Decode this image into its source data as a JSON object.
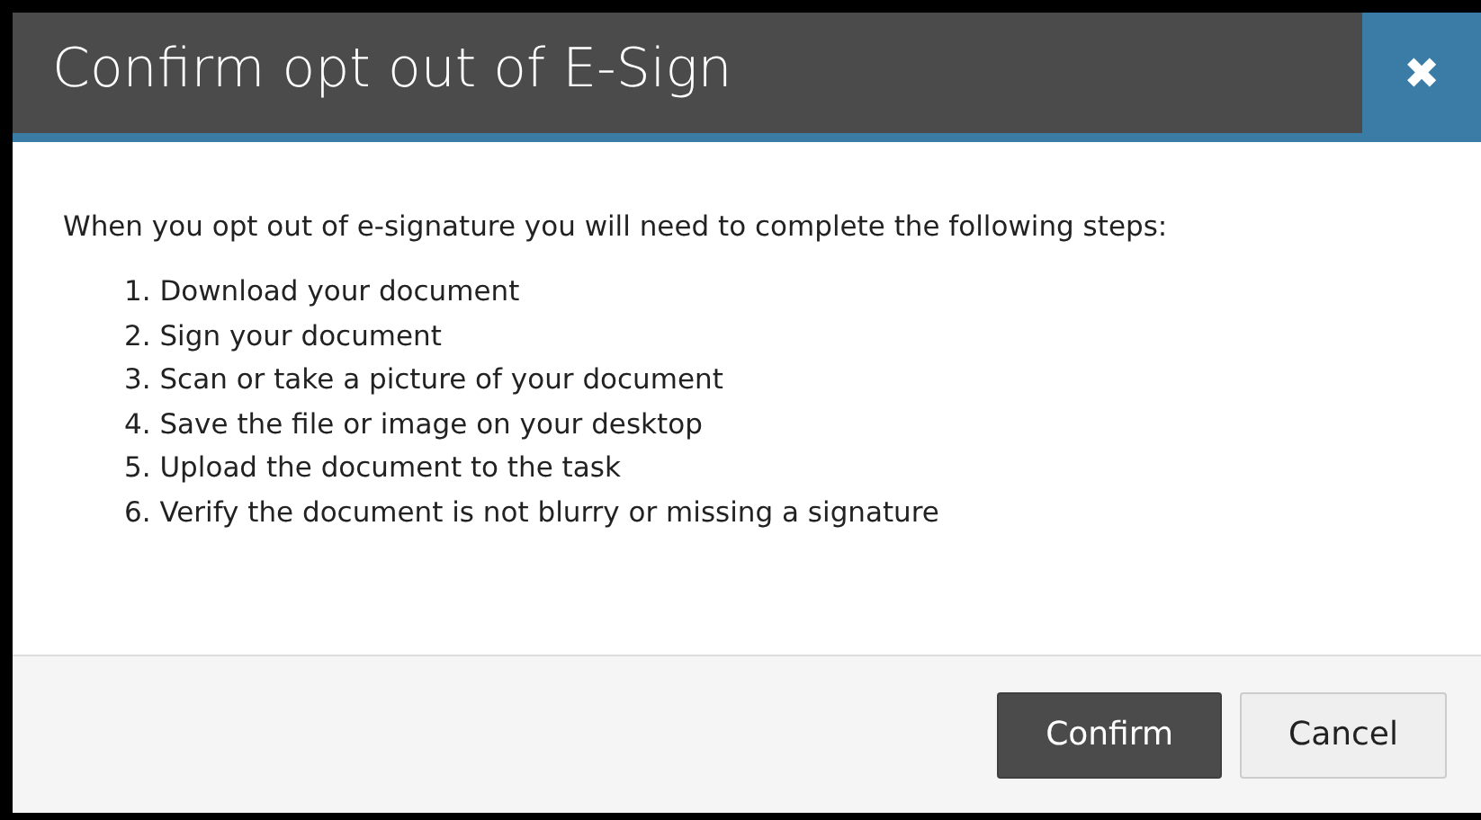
{
  "dialog": {
    "title": "Confirm opt out of E-Sign",
    "close_symbol": "✖",
    "intro": "When you opt out of e-signature you will need to complete the following steps:",
    "steps": [
      "1. Download your document",
      "2. Sign your document",
      "3. Scan or take a picture of your document",
      "4. Save the file or image on your desktop",
      "5. Upload the document to the task",
      "6. Verify the document is not blurry or missing a signature"
    ],
    "buttons": [
      {
        "label": "Confirm",
        "kind": "primary"
      },
      {
        "label": "Cancel",
        "kind": "secondary"
      }
    ]
  }
}
